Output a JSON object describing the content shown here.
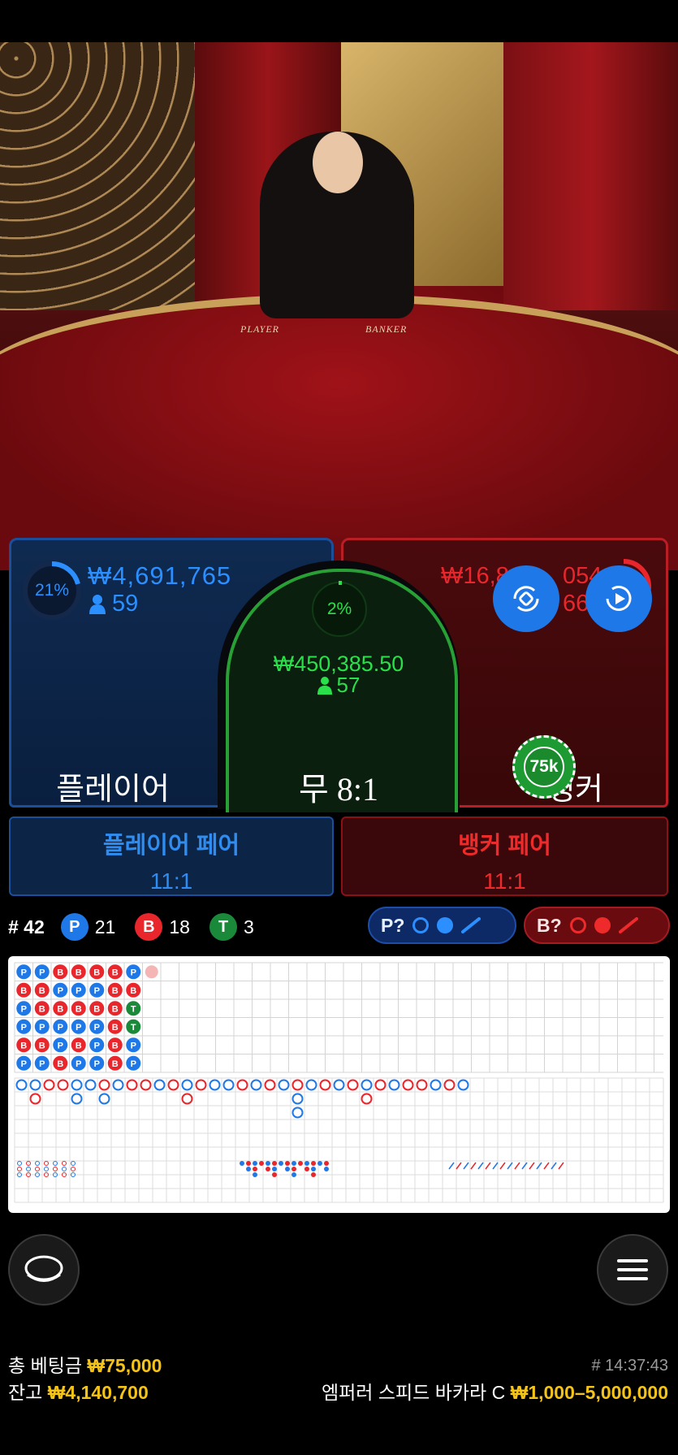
{
  "table_felt": {
    "player_label": "PLAYER",
    "banker_label": "BANKER"
  },
  "player": {
    "percent": "21%",
    "percent_fraction": 0.21,
    "amount": "₩4,691,765",
    "bettors": "59",
    "label": "플레이어"
  },
  "tie": {
    "percent": "2%",
    "percent_fraction": 0.02,
    "amount": "₩450,385.50",
    "bettors": "57",
    "label": "무 8:1"
  },
  "banker": {
    "amount_partial_start": "₩16,8",
    "amount_partial_end": "054",
    "bettors_partial": "66",
    "label_visible": "뱅커",
    "chip_value": "75k"
  },
  "player_pair": {
    "label": "플레이어 페어",
    "odds": "11:1"
  },
  "banker_pair": {
    "label": "뱅커 페어",
    "odds": "11:1"
  },
  "stats": {
    "round": "# 42",
    "p_letter": "P",
    "p_count": "21",
    "b_letter": "B",
    "b_count": "18",
    "t_letter": "T",
    "t_count": "3"
  },
  "predict": {
    "player": "P?",
    "banker": "B?"
  },
  "colors": {
    "player": "#1f78e8",
    "banker": "#e8262c",
    "tie": "#1a8a3a",
    "gold": "#f4c318"
  },
  "icons": {
    "swap_camera": "camera-rotate-icon",
    "video": "video-play-icon",
    "chat": "chat-icon",
    "menu": "menu-icon"
  },
  "bead_road": [
    [
      "P",
      "B",
      "P",
      "P",
      "B",
      "P"
    ],
    [
      "P",
      "B",
      "B",
      "P",
      "B",
      "P"
    ],
    [
      "B",
      "P",
      "B",
      "P",
      "P",
      "B"
    ],
    [
      "B",
      "P",
      "B",
      "P",
      "B",
      "P"
    ],
    [
      "B",
      "P",
      "B",
      "P",
      "P",
      "P"
    ],
    [
      "B",
      "B",
      "B",
      "B",
      "B",
      "B"
    ],
    [
      "P",
      "B",
      "T",
      "T",
      "P",
      "P"
    ]
  ],
  "footer": {
    "total_bet_label": "총 베팅금",
    "total_bet_value": "₩75,000",
    "balance_label": "잔고",
    "balance_value": "₩4,140,700",
    "round_time": "# 14:37:43",
    "table_name": "엠퍼러 스피드 바카라 C",
    "limits": "₩1,000–5,000,000"
  }
}
